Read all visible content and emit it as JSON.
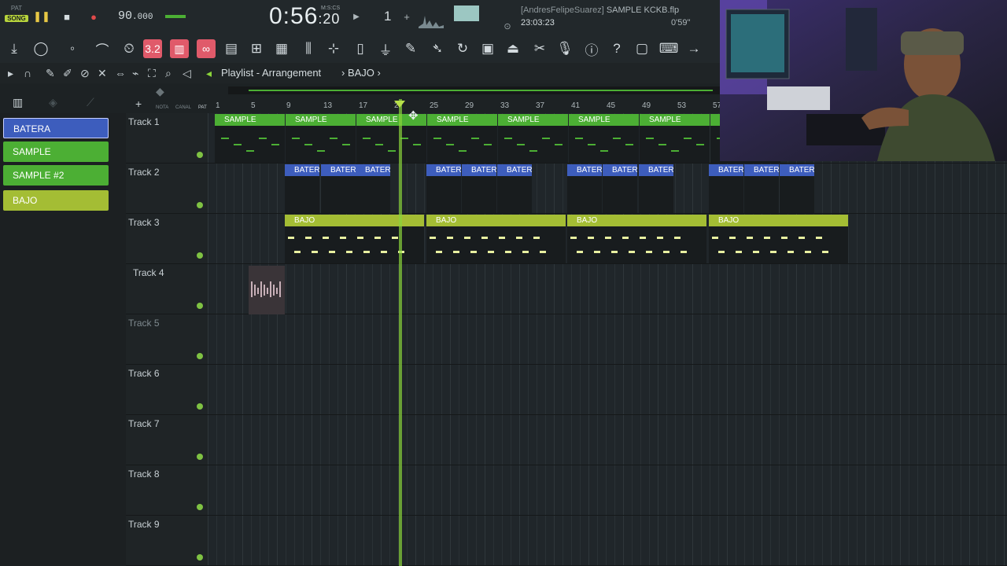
{
  "transport": {
    "pat_label": "PAT",
    "song_label": "SONG",
    "tempo": "90",
    "tempo_decimals": ".000",
    "time_main": "0:56",
    "time_sub": "20",
    "time_unit": "M:S:CS",
    "pattern_number": "1",
    "project_user": "[AndresFelipeSuarez]",
    "project_name": "SAMPLE KCKB.flp",
    "clock": "23:03:23",
    "duration": "0'59''"
  },
  "playlist": {
    "title": "Playlist - Arrangement",
    "breadcrumb": "BAJO",
    "mini_labels": [
      "NOTA",
      "CANAL",
      "PAT"
    ],
    "ruler": [
      "1",
      "5",
      "9",
      "13",
      "17",
      "2",
      "25",
      "29",
      "33",
      "37",
      "41",
      "45",
      "49",
      "53",
      "57"
    ]
  },
  "patterns": [
    {
      "label": "BATERA",
      "color": "#3d5dbd"
    },
    {
      "label": "SAMPLE",
      "color": "#4caf34"
    },
    {
      "label": "SAMPLE #2",
      "color": "#4caf34"
    },
    {
      "label": "BAJO",
      "color": "#a4bd34"
    }
  ],
  "tracks": [
    "Track 1",
    "Track 2",
    "Track 3",
    "Track 4",
    "Track 5",
    "Track 6",
    "Track 7",
    "Track 8",
    "Track 9"
  ],
  "clips": {
    "sample_label": "SAMPLE",
    "batera_label": "BATERA",
    "bajo_label": "BAJO"
  },
  "colors": {
    "sample": "#4caf34",
    "batera": "#3d5dbd",
    "bajo": "#a4bd34",
    "accent": "#8ad43a"
  }
}
